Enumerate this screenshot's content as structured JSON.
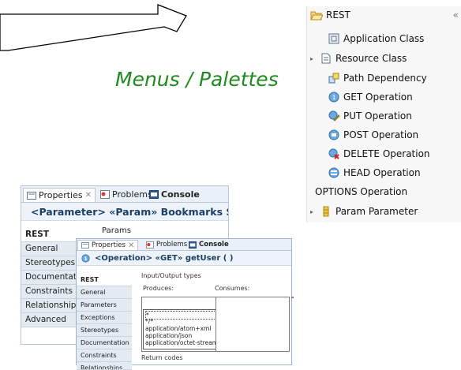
{
  "caption": "Menus / Palettes",
  "palette": {
    "header": "REST",
    "collapse_glyph": "«",
    "items": [
      {
        "label": "Application Class",
        "icon": "application-class-icon"
      },
      {
        "label": "Resource Class",
        "icon": "resource-class-icon",
        "expandable": true
      },
      {
        "label": "Path Dependency",
        "icon": "path-dependency-icon"
      },
      {
        "label": "GET Operation",
        "icon": "get-operation-icon"
      },
      {
        "label": "PUT Operation",
        "icon": "put-operation-icon"
      },
      {
        "label": "POST Operation",
        "icon": "post-operation-icon"
      },
      {
        "label": "DELETE Operation",
        "icon": "delete-operation-icon"
      },
      {
        "label": "HEAD Operation",
        "icon": "head-operation-icon"
      },
      {
        "label": "OPTIONS Operation",
        "icon": ""
      },
      {
        "label": "Param Parameter",
        "icon": "param-parameter-icon",
        "expandable": true
      }
    ]
  },
  "panel_back": {
    "tabs": [
      "Properties",
      "Problems",
      "Console"
    ],
    "tab_close": "✕",
    "title": "<Parameter> «Param» Bookmarks Servic",
    "params_label": "Params",
    "sidebar": [
      "REST",
      "General",
      "Stereotypes",
      "Documentatio",
      "Constraints",
      "Relationships",
      "Advanced"
    ]
  },
  "panel_front": {
    "tabs": [
      "Properties",
      "Problems",
      "Console"
    ],
    "tab_close": "✕",
    "title": "<Operation> «GET» getUser ( )",
    "sidebar": [
      "REST",
      "General",
      "Parameters",
      "Exceptions",
      "Stereotypes",
      "Documentation",
      "Constraints",
      "Relationships"
    ],
    "group_label": "Input/Output types",
    "produces_label": "Produces:",
    "consumes_label": "Consumes:",
    "dropdown_options": [
      "*",
      "*/*",
      "application/atom+xml",
      "application/json",
      "application/octet-stream"
    ],
    "return_codes_label": "Return codes"
  },
  "colors": {
    "caption": "#1e8a1e",
    "title_text": "#1b3f66",
    "tab_bar": "#eaf0f7"
  }
}
